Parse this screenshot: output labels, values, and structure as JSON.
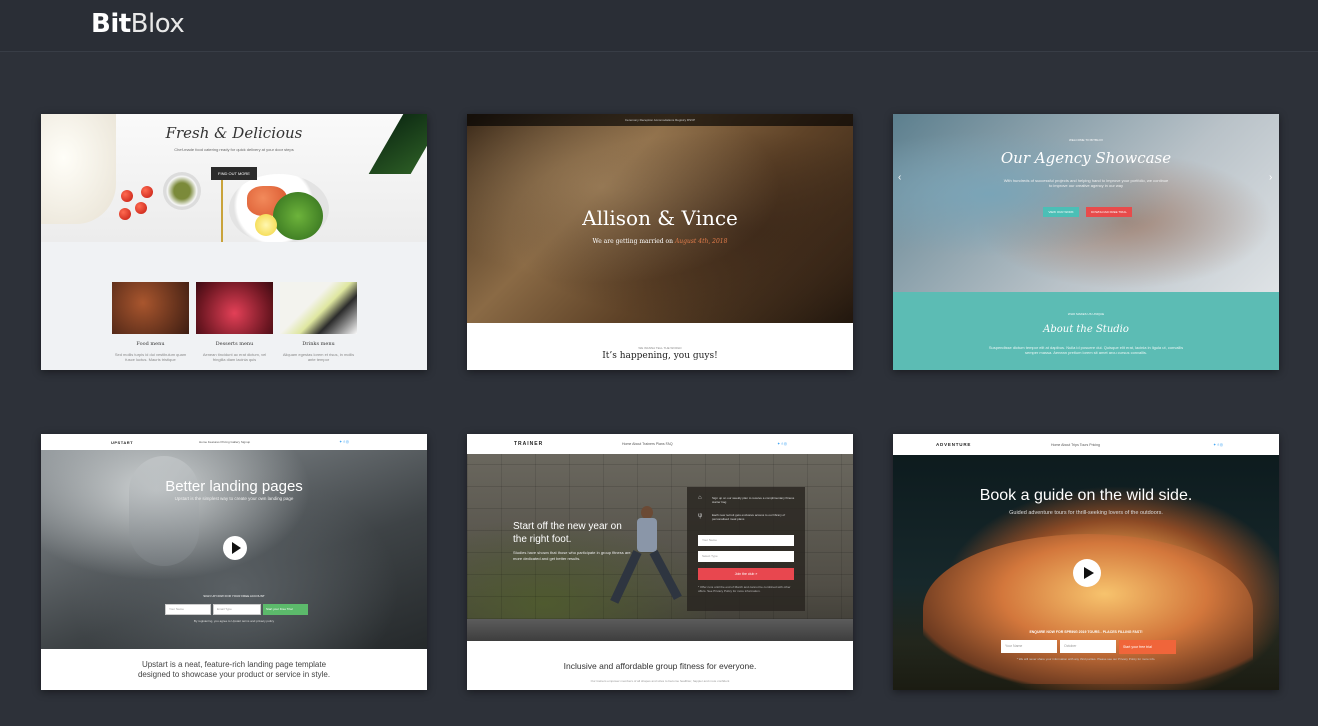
{
  "app": {
    "logo_bold": "Bit",
    "logo_light": "Blox"
  },
  "colors": {
    "background": "#2d3139",
    "topbar": "#2a2e36"
  },
  "templates": {
    "food": {
      "title": "Fresh & Delicious",
      "subtitle": "Chef-made food catering ready for quick delivery at your door steps",
      "cta": "FIND OUT MORE",
      "menus": [
        {
          "label": "Food menu",
          "desc": "Sed mollis turpis id dui vestibulum quam fusce luctus. Mauris tristique"
        },
        {
          "label": "Desserts menu",
          "desc": "Aenean tincidunt ac erat dictum, vel fringilla diam lacinia quis"
        },
        {
          "label": "Drinks menu",
          "desc": "Aliquam egestas lorem et risus, in mollis ante tempor"
        }
      ]
    },
    "wedding": {
      "nav": "Ceremony     Reception     Accomodations     Registry     RSVP",
      "names": "Allison & Vince",
      "sub_prefix": "We are getting married on",
      "sub_accent": "August 4th, 2018",
      "small": "WE WANNA TELL THE WORLD",
      "headline": "It’s happening, you guys!"
    },
    "agency": {
      "pre": "WELCOME TO BITBLOX",
      "title": "Our Agency Showcase",
      "desc": "With hundreds of successful projects and helping hand to improve your portfolio, we continue to improve our creative agency in our way",
      "btn1": "VIEW OUR WORK",
      "btn2": "DOWNLOAD FREE TRIAL",
      "arrow_left": "‹",
      "arrow_right": "›",
      "about_pre": "WHO MAKES US UNIQUE",
      "about": "About the Studio",
      "about_desc": "Suspendisse dictum tempor elit at dapibus. Nulla id posuere dui. Quisque elit erat, lacinia in ligula ut, convallis semper massa. Aenean pretium lorem sit amet arcu cursus convallis."
    },
    "upstart": {
      "brand": "UPSTART",
      "nav": "Home   Features   Pricing   Gallery   Signup",
      "social": "✦  f  ◎",
      "headline": "Better landing pages",
      "sub": "Upstart is the simplest way to create your own landing page",
      "form_title": "SIGN UP NOW FOR YOUR FREE ACCOUNT",
      "input1": "Your Name",
      "input2": "Email Type",
      "button": "Start your Free Trial",
      "disclaimer": "By registering, you agree to Upstart terms and privacy policy",
      "desc_line1": "Upstart is a neat, feature-rich landing page template",
      "desc_line2": "designed to showcase your product or service in style."
    },
    "trainer": {
      "brand": "TRAINER",
      "nav": "Home   About   Trainers   Plans   FAQ",
      "social": "✦  f  ◎",
      "headline": "Start off the new year on the right foot.",
      "sub": "Studies have shown that those who participate in group fitness are more dedicated and get better results.",
      "form_text1": "Sign up on our weekly plan to receive a complimentary fitness starter bag",
      "form_text2": "Each new recruit gets exclusive access to our library of personalised meal plans",
      "input1": "Your Name",
      "input2": "Select Type",
      "button": "Join the club »",
      "note": "* Offer runs until the end of March and cannot be combined with other offers. See Privacy Policy for more information.",
      "tagline": "Inclusive and affordable group fitness for everyone.",
      "tagline2": "Our trainers empower members of all shapes and sizes to become healthier, happier and more confident"
    },
    "adventure": {
      "brand": "ADVENTURE",
      "nav": "Home   About   Trips   Tours   Pricing",
      "social": "✦  f  ◎",
      "headline": "Book a guide on the wild side.",
      "sub": "Guided adventure tours for thrill-seeking lovers of the outdoors.",
      "form_title": "ENQUIRE NOW FOR SPRING 2019 TOURS - PLACES FILLING FAST!",
      "input1": "Your Name",
      "input2": "October",
      "button": "Start your free trial",
      "disclaimer": "* We will never share your information with any third parties. Please see our Privacy Policy for more info."
    }
  }
}
